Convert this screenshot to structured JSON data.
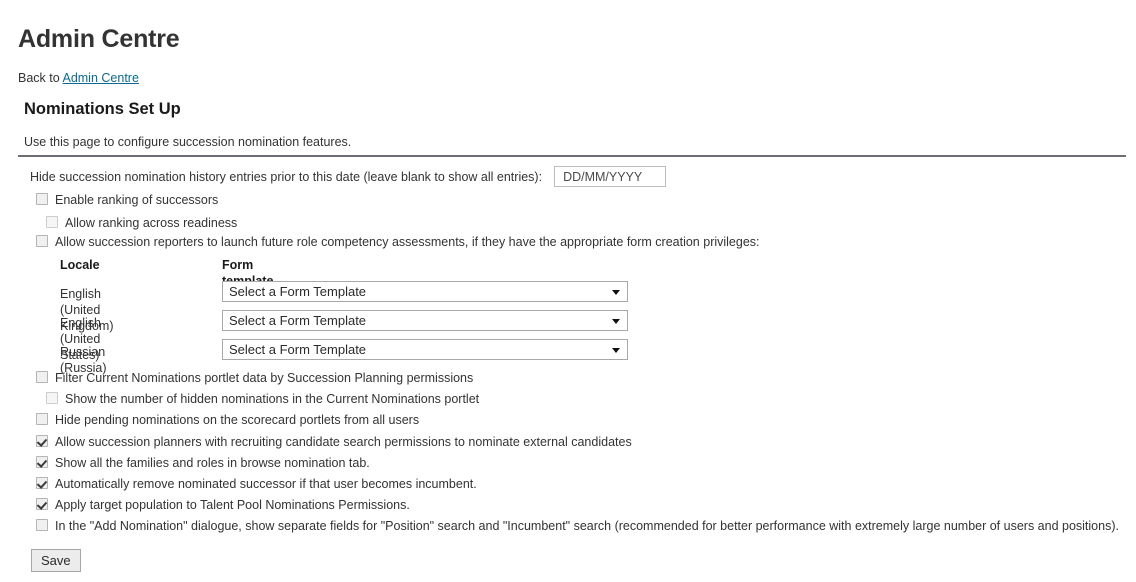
{
  "header": {
    "app_title": "Admin Centre",
    "back_prefix": "Back to",
    "back_link": "Admin Centre",
    "section_title": "Nominations Set Up",
    "section_desc": "Use this page to configure succession nomination features."
  },
  "date_setting": {
    "label": "Hide succession nomination history entries prior to this date (leave blank to show all entries):",
    "placeholder": "DD/MM/YYYY",
    "value": ""
  },
  "options": {
    "enable_ranking": {
      "label": "Enable ranking of successors",
      "checked": false,
      "indent": 0
    },
    "ranking_across_readiness": {
      "label": "Allow ranking across readiness",
      "checked": false,
      "indent": 1
    },
    "launch_future_role": {
      "label": "Allow succession reporters to launch future role competency assessments, if they have the appropriate form creation privileges:",
      "checked": false,
      "indent": 0
    },
    "filter_current_nominations": {
      "label": "Filter Current Nominations portlet data by Succession Planning permissions",
      "checked": false,
      "indent": 0
    },
    "show_hidden_count": {
      "label": "Show the number of hidden nominations in the Current Nominations portlet",
      "checked": false,
      "indent": 1
    },
    "hide_pending": {
      "label": "Hide pending nominations on the scorecard portlets from all users",
      "checked": false,
      "indent": 0
    },
    "external_candidates": {
      "label": "Allow succession planners with recruiting candidate search permissions to nominate external candidates",
      "checked": true,
      "indent": 0
    },
    "show_all_families": {
      "label": "Show all the families and roles in browse nomination tab.",
      "checked": true,
      "indent": 0
    },
    "auto_remove_successor": {
      "label": "Automatically remove nominated successor if that user becomes incumbent.",
      "checked": true,
      "indent": 0
    },
    "target_population": {
      "label": "Apply target population to Talent Pool Nominations Permissions.",
      "checked": true,
      "indent": 0
    },
    "separate_fields": {
      "label": "In the \"Add Nomination\" dialogue, show separate fields for \"Position\" search and \"Incumbent\" search (recommended for better performance with extremely large number of users and positions).",
      "checked": false,
      "indent": 0
    }
  },
  "locale_table": {
    "headers": {
      "locale": "Locale",
      "form_template": "Form template"
    },
    "rows": [
      {
        "locale": "English (United Kingdom)",
        "template": "Select a Form Template"
      },
      {
        "locale": "English (United States)",
        "template": "Select a Form Template"
      },
      {
        "locale": "Russian (Russia)",
        "template": "Select a Form Template"
      }
    ]
  },
  "actions": {
    "save_label": "Save"
  },
  "colors": {
    "link": "#0b6a8f",
    "divider": "#6d6e71",
    "text": "#333333"
  }
}
